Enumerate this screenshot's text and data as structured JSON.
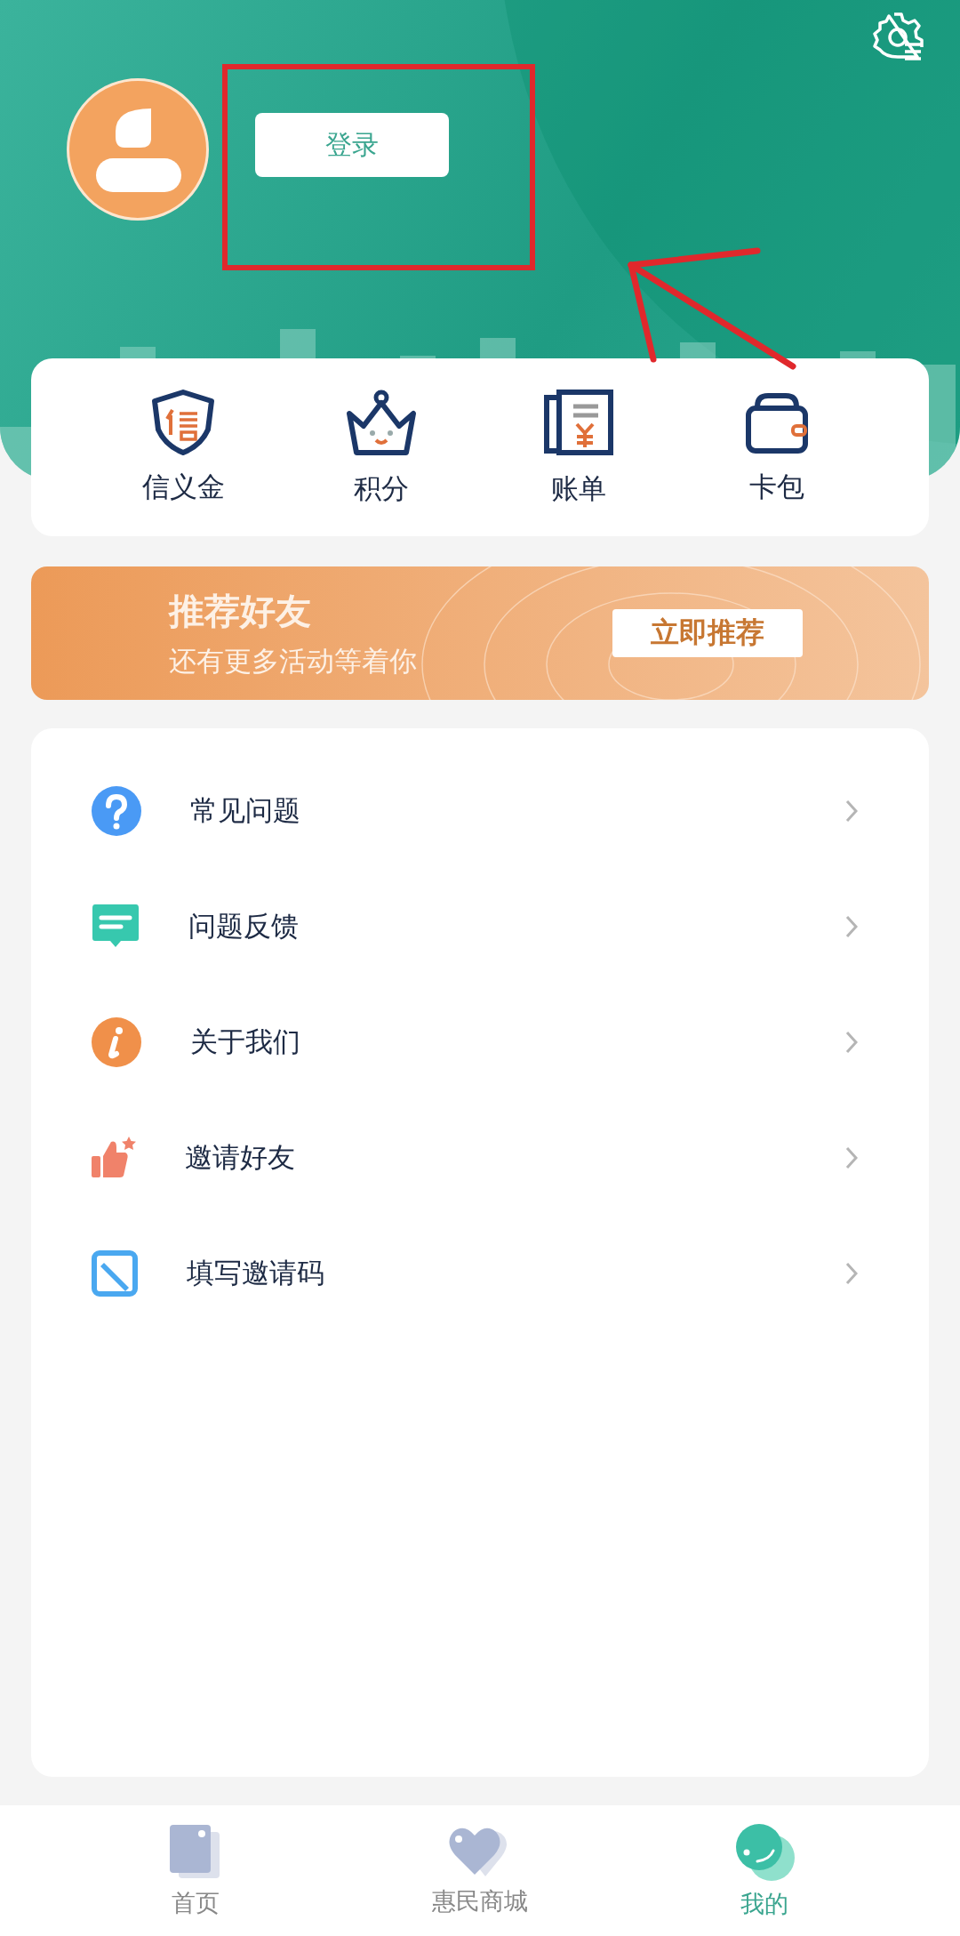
{
  "header": {
    "login_button": "登录"
  },
  "quick_actions": [
    {
      "label": "信义金"
    },
    {
      "label": "积分"
    },
    {
      "label": "账单"
    },
    {
      "label": "卡包"
    }
  ],
  "banner": {
    "title": "推荐好友",
    "subtitle": "还有更多活动等着你",
    "button": "立即推荐"
  },
  "menu": [
    {
      "label": "常见问题"
    },
    {
      "label": "问题反馈"
    },
    {
      "label": "关于我们"
    },
    {
      "label": "邀请好友"
    },
    {
      "label": "填写邀请码"
    }
  ],
  "tab_bar": [
    {
      "label": "首页",
      "selected": false
    },
    {
      "label": "惠民商城",
      "selected": false
    },
    {
      "label": "我的",
      "selected": true
    }
  ]
}
